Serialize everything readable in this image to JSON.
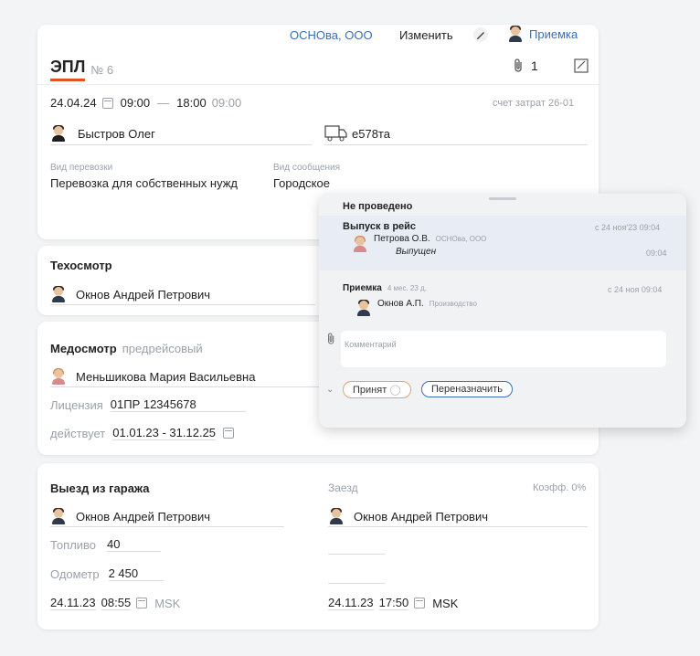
{
  "header": {
    "org": "ОСНОва, ООО",
    "edit_label": "Изменить",
    "role_label": "Приемка",
    "title": "ЭПЛ",
    "number": "№ 6",
    "attach_count": "1"
  },
  "trip": {
    "date": "24.04.24",
    "time_from": "09:00",
    "dash": "—",
    "time_to": "18:00",
    "time_actual": "09:00",
    "cost_account": "счет затрат 26-01",
    "driver": "Быстров Олег",
    "vehicle": "е578та",
    "transport_type_label": "Вид перевозки",
    "transport_type": "Перевозка для собственных нужд",
    "message_type_label": "Вид сообщения",
    "message_type": "Городское"
  },
  "tech": {
    "title": "Техосмотр",
    "person": "Окнов Андрей Петрович"
  },
  "med": {
    "title": "Медосмотр",
    "subtitle": "предрейсовый",
    "person": "Меньшикова Мария Васильевна",
    "license_label": "Лицензия",
    "license": "01ПР 12345678",
    "valid_label": "действует",
    "valid": "01.01.23 - 31.12.25"
  },
  "garage": {
    "exit_title": "Выезд из гаража",
    "return_title": "Заезд",
    "coef": "Коэфф. 0%",
    "exit_person": "Окнов Андрей Петрович",
    "return_person": "Окнов Андрей Петрович",
    "fuel_label": "Топливо",
    "fuel": "40",
    "odo_label": "Одометр",
    "odo": "2 450",
    "exit_date": "24.11.23",
    "exit_time": "08:55",
    "exit_tz": "MSK",
    "return_date": "24.11.23",
    "return_time": "17:50",
    "return_tz": "MSK"
  },
  "popup": {
    "status": "Не проведено",
    "step1_title": "Выпуск в рейс",
    "step1_date": "с 24 ноя'23 09:04",
    "step1_person": "Петрова О.В.",
    "step1_org": "ОСНОва, ООО",
    "step1_state": "Выпущен",
    "step1_time": "09:04",
    "step2_title": "Приемка",
    "step2_ago": "4 мес. 23 д.",
    "step2_date": "с 24 ноя 09:04",
    "step2_person": "Окнов А.П.",
    "step2_dept": "Производство",
    "comment_placeholder": "Комментарий",
    "accept_label": "Принят",
    "reassign_label": "Переназначить"
  },
  "colors": {
    "accent": "#e0531f",
    "blue": "#3a6fb0",
    "pill_orange": "#e8a070"
  }
}
